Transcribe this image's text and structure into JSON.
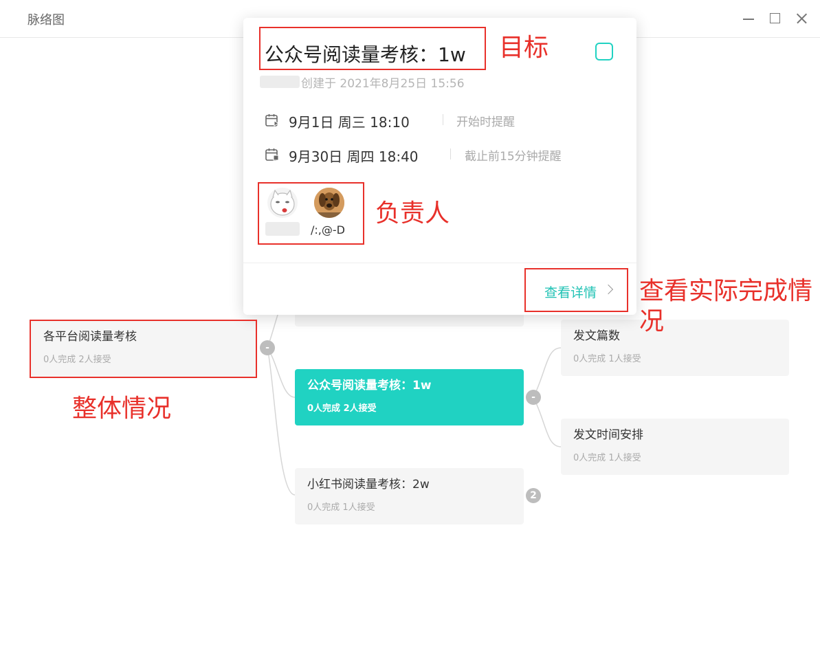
{
  "window": {
    "title": "脉络图"
  },
  "mindmap": {
    "root": {
      "title": "各平台阅读量考核",
      "meta": "0人完成 2人接受",
      "toggle": "-"
    },
    "children": [
      {
        "title": "公众号阅读量考核：1w",
        "meta": "0人完成 2人接受",
        "toggle": "-",
        "active": true
      },
      {
        "title": "小红书阅读量考核：2w",
        "meta": "0人完成 1人接受",
        "toggle": "2"
      }
    ],
    "grandchildren": [
      {
        "title": "发文篇数",
        "meta": "0人完成 1人接受"
      },
      {
        "title": "发文时间安排",
        "meta": "0人完成 1人接受"
      }
    ]
  },
  "popup": {
    "title": "公众号阅读量考核：1w",
    "created": "创建于 2021年8月25日 15:56",
    "start": {
      "date": "9月1日 周三 18:10",
      "remind": "开始时提醒"
    },
    "end": {
      "date": "9月30日 周四 18:40",
      "remind": "截止前15分钟提醒"
    },
    "assignees": [
      {
        "name": "",
        "avatar": "cartoon-face"
      },
      {
        "name": "/:,@-D",
        "avatar": "dog-photo"
      }
    ],
    "detail_label": "查看详情"
  },
  "annotations": {
    "goal": "目标",
    "owner": "负责人",
    "detail": "查看实际完成情况",
    "overview": "整体情况"
  },
  "colors": {
    "accent": "#20d2c2",
    "annotation": "#e8302a"
  }
}
